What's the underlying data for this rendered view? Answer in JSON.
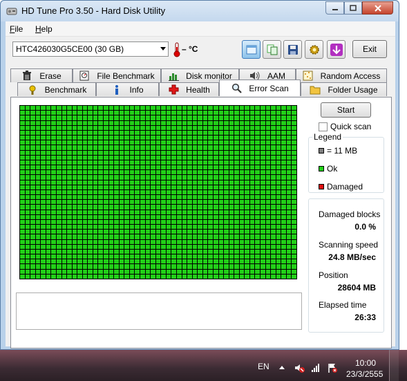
{
  "window": {
    "title": "HD Tune Pro 3.50 - Hard Disk Utility"
  },
  "menubar": {
    "file_rest": "ile",
    "help_rest": "elp",
    "file_key": "F",
    "help_key": "H"
  },
  "toolbar": {
    "drive": "HTC426030G5CE00 (30 GB)",
    "temperature": "– °C",
    "exit_label": "Exit"
  },
  "tabs": {
    "row1": [
      {
        "label": "Erase",
        "icon": "trash-icon"
      },
      {
        "label": "File Benchmark",
        "icon": "file-benchmark-icon"
      },
      {
        "label": "Disk monitor",
        "icon": "disk-monitor-icon"
      },
      {
        "label": "AAM",
        "icon": "speaker-icon"
      },
      {
        "label": "Random Access",
        "icon": "random-access-icon"
      }
    ],
    "row2": [
      {
        "label": "Benchmark",
        "icon": "benchmark-icon"
      },
      {
        "label": "Info",
        "icon": "info-icon"
      },
      {
        "label": "Health",
        "icon": "health-cross-icon"
      },
      {
        "label": "Error Scan",
        "icon": "magnifier-icon",
        "active": true
      },
      {
        "label": "Folder Usage",
        "icon": "folder-icon"
      }
    ]
  },
  "scan": {
    "start_label": "Start",
    "quick_scan_label": "Quick scan",
    "quick_scan_checked": false
  },
  "legend": {
    "title": "Legend",
    "block_size": "= 11 MB",
    "ok": "Ok",
    "damaged": "Damaged",
    "colors": {
      "block": "#808080",
      "ok": "#22d018",
      "damaged": "#e01010"
    }
  },
  "stats": {
    "damaged_blocks_label": "Damaged blocks",
    "damaged_blocks_value": "0.0 %",
    "scanning_speed_label": "Scanning speed",
    "scanning_speed_value": "24.8 MB/sec",
    "position_label": "Position",
    "position_value": "28604 MB",
    "elapsed_label": "Elapsed time",
    "elapsed_value": "26:33"
  },
  "taskbar": {
    "language": "EN",
    "time": "10:00",
    "date": "23/3/2555"
  }
}
